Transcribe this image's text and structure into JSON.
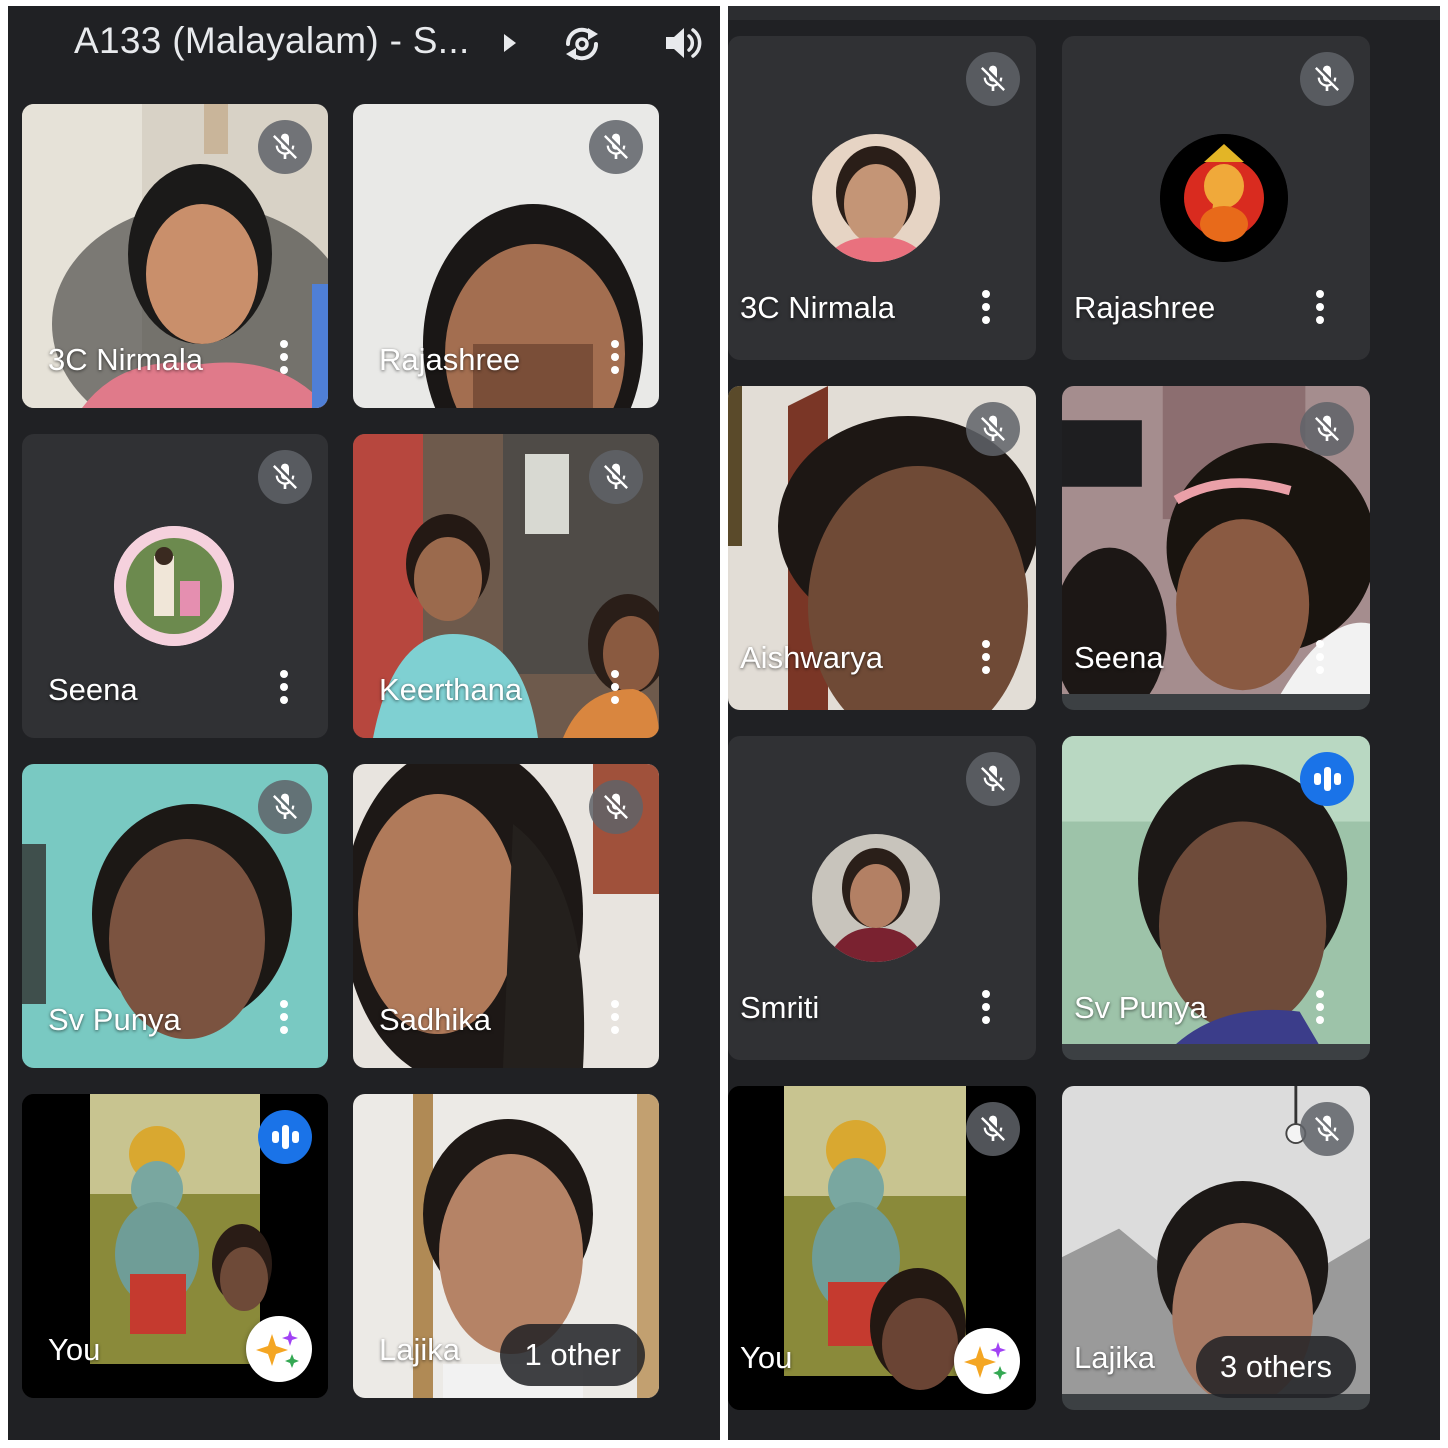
{
  "left": {
    "header": {
      "title": "A133 (Malayalam) - S...",
      "icons": [
        "play-arrow-icon",
        "switch-camera-icon",
        "speaker-icon"
      ]
    },
    "tiles": [
      {
        "name": "3C Nirmala",
        "mic": "muted",
        "view": "video"
      },
      {
        "name": "Rajashree",
        "mic": "muted",
        "view": "video"
      },
      {
        "name": "Seena",
        "mic": "muted",
        "view": "avatar"
      },
      {
        "name": "Keerthana",
        "mic": "muted",
        "view": "video"
      },
      {
        "name": "Sv Punya",
        "mic": "muted",
        "view": "video"
      },
      {
        "name": "Sadhika",
        "mic": "muted",
        "view": "video"
      },
      {
        "name": "You",
        "mic": "speaking",
        "view": "video"
      },
      {
        "name": "Lajika",
        "others": "1 other",
        "view": "video"
      }
    ]
  },
  "right": {
    "tiles": [
      {
        "name": "3C Nirmala",
        "mic": "muted",
        "view": "avatar"
      },
      {
        "name": "Rajashree",
        "mic": "muted",
        "view": "avatar"
      },
      {
        "name": "Aishwarya",
        "mic": "muted",
        "view": "video"
      },
      {
        "name": "Seena",
        "mic": "muted",
        "view": "video"
      },
      {
        "name": "Smriti",
        "mic": "muted",
        "view": "avatar"
      },
      {
        "name": "Sv Punya",
        "mic": "speaking",
        "view": "video"
      },
      {
        "name": "You",
        "mic": "muted",
        "view": "video"
      },
      {
        "name": "Lajika",
        "others": "3 others",
        "mic": "muted",
        "view": "video"
      }
    ]
  },
  "colors": {
    "background": "#202124",
    "tile": "#3c4043",
    "speaking": "#1a73e8",
    "mute_badge": "#5f6368",
    "text": "#ffffff"
  }
}
